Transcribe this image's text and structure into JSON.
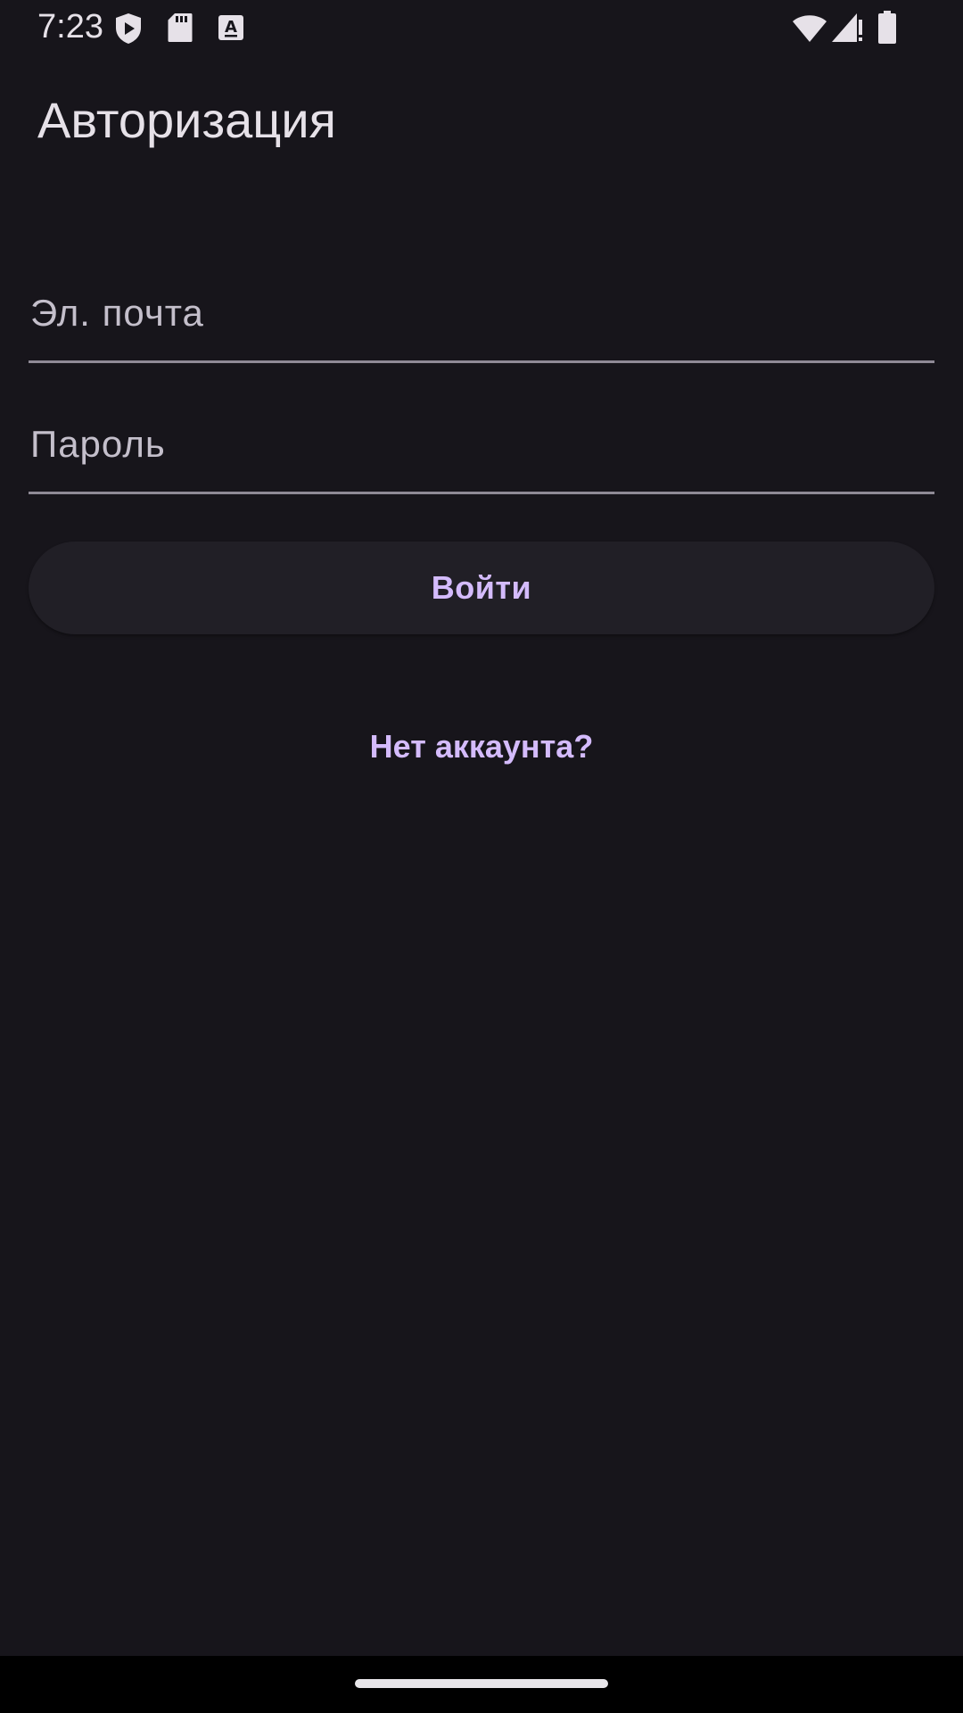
{
  "status_bar": {
    "time": "7:23",
    "icons_left": [
      "play-protect-icon",
      "sd-card-icon",
      "autofill-a-icon"
    ],
    "icons_right": [
      "wifi-icon",
      "cell-signal-icon",
      "battery-icon"
    ]
  },
  "header": {
    "title": "Авторизация"
  },
  "form": {
    "email_placeholder": "Эл. почта",
    "email_value": "",
    "password_placeholder": "Пароль",
    "password_value": "",
    "login_label": "Войти",
    "register_link": "Нет аккаунта?"
  },
  "colors": {
    "background": "#17151b",
    "accent": "#d4bbfc",
    "text": "#e6e1e8",
    "button_bg": "#211f26"
  }
}
